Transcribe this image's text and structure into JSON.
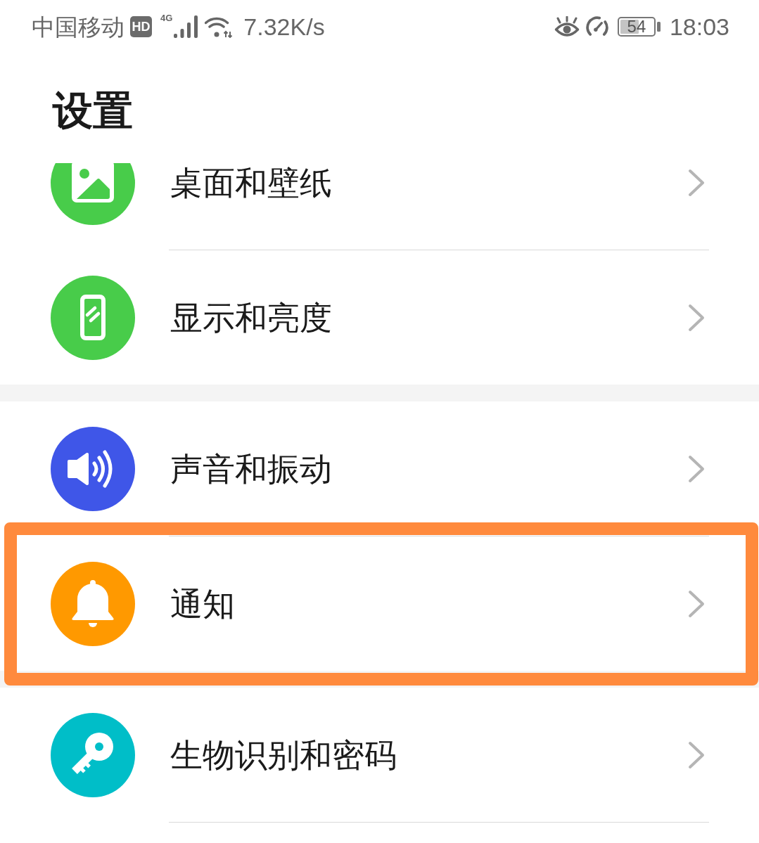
{
  "status_bar": {
    "carrier": "中国移动",
    "hd_badge": "HD",
    "network_type": "4G",
    "speed": "7.32K/s",
    "battery": "54",
    "time": "18:03"
  },
  "title": "设置",
  "groups": [
    {
      "items": [
        {
          "kind": "wallpaper",
          "label": "桌面和壁纸",
          "color": "#48cc4a",
          "highlighted": false
        },
        {
          "kind": "display",
          "label": "显示和亮度",
          "color": "#48cc4a",
          "highlighted": false
        }
      ]
    },
    {
      "items": [
        {
          "kind": "sound",
          "label": "声音和振动",
          "color": "#3f56e8",
          "highlighted": false
        },
        {
          "kind": "notifications",
          "label": "通知",
          "color": "#ff9900",
          "highlighted": true
        }
      ]
    },
    {
      "items": [
        {
          "kind": "security",
          "label": "生物识别和密码",
          "color": "#00bec8",
          "highlighted": false
        }
      ]
    }
  ]
}
